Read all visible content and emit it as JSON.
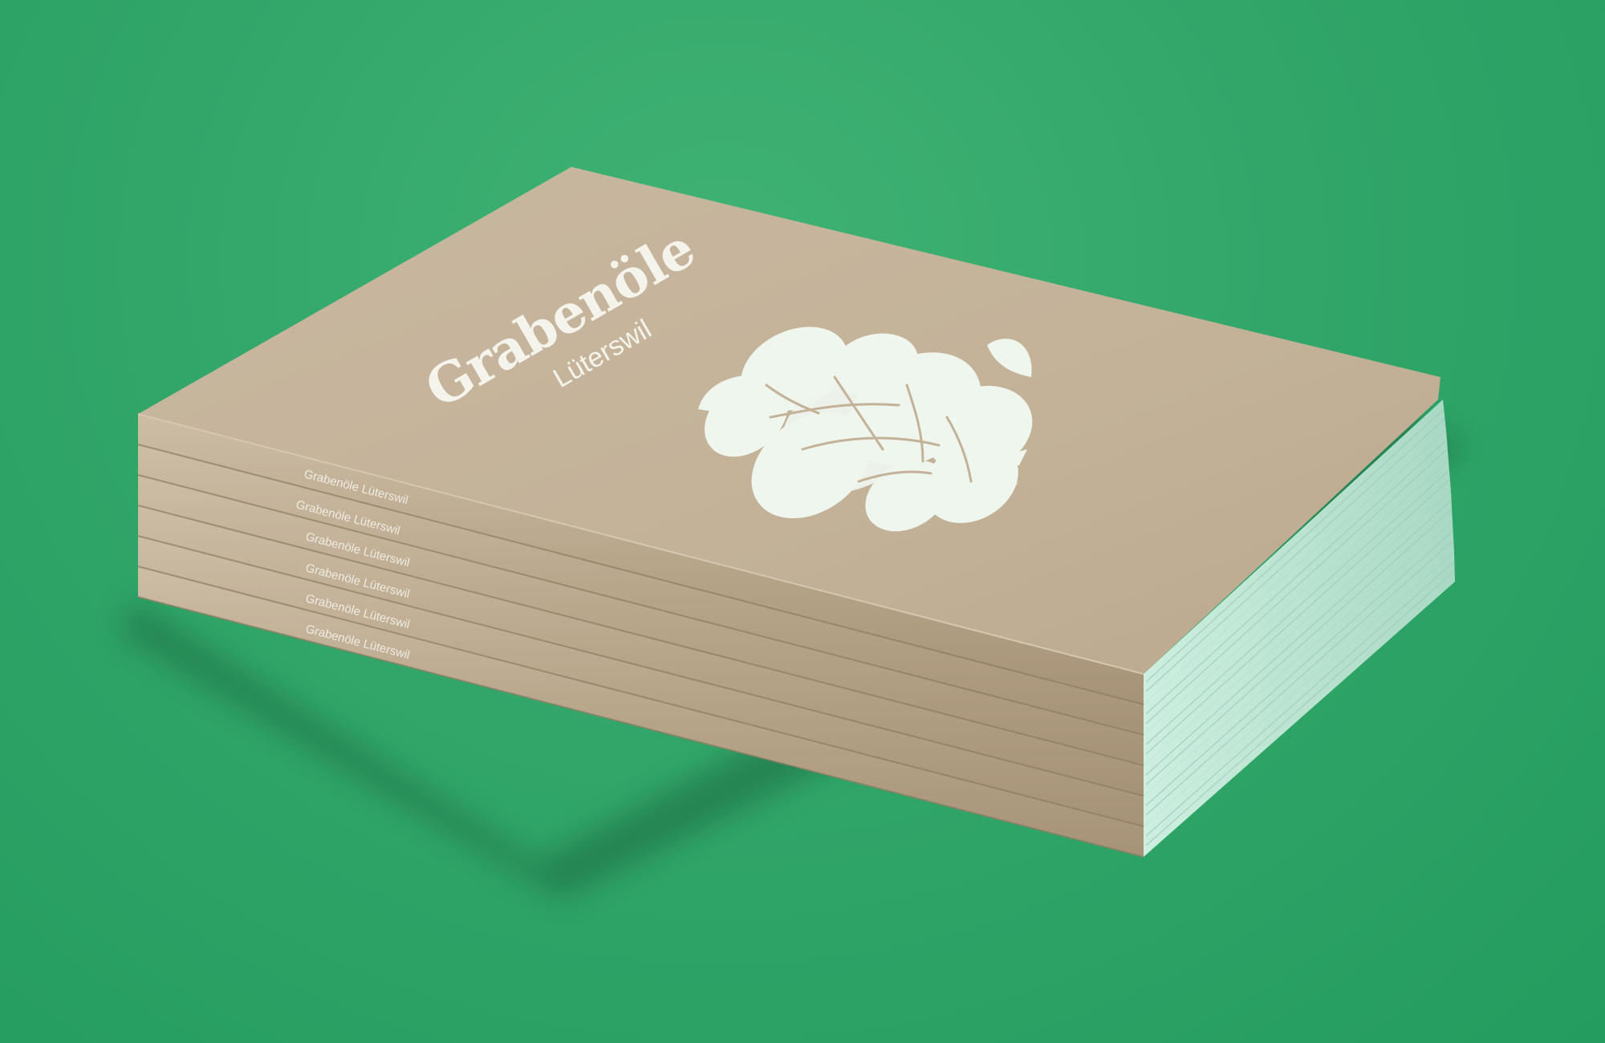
{
  "scene": {
    "background_color": "#32a669",
    "cover_color": "#c4b39b",
    "spine_color": "#b9a68c",
    "page_edge_color": "#bfe5d4",
    "print_color": "#f4f4ec"
  },
  "cover": {
    "title": "Grabenöle",
    "subtitle": "Lüterswil",
    "illustration": "botanical-plant-illustration"
  },
  "spines": [
    {
      "label": "Grabenöle Lüterswil"
    },
    {
      "label": "Grabenöle Lüterswil"
    },
    {
      "label": "Grabenöle Lüterswil"
    },
    {
      "label": "Grabenöle Lüterswil"
    },
    {
      "label": "Grabenöle Lüterswil"
    },
    {
      "label": "Grabenöle Lüterswil"
    }
  ]
}
